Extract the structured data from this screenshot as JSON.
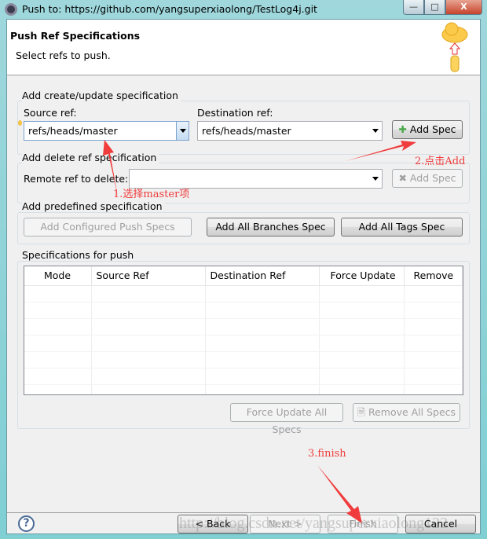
{
  "window": {
    "title": "Push to: https://github.com/yangsuperxiaolong/TestLog4j.git",
    "minimize": "—",
    "maximize": "□",
    "close": "X"
  },
  "header": {
    "title": "Push Ref Specifications",
    "subtitle": "Select refs to push.",
    "icon": "cloud-push-icon"
  },
  "create_group": {
    "title": "Add create/update specification",
    "source_label": "Source ref:",
    "source_value": "refs/heads/master",
    "dest_label": "Destination ref:",
    "dest_value": "refs/heads/master",
    "add_button": "Add Spec"
  },
  "delete_group": {
    "title": "Add delete ref specification",
    "remote_label": "Remote ref to delete:",
    "remote_value": "",
    "add_button": "Add Spec"
  },
  "predefined_group": {
    "title": "Add predefined specification",
    "buttons": [
      "Add Configured Push Specs",
      "Add All Branches Spec",
      "Add All Tags Spec"
    ]
  },
  "specs_group": {
    "title": "Specifications for push",
    "columns": [
      "Mode",
      "Source Ref",
      "Destination Ref",
      "Force Update",
      "Remove"
    ],
    "rows": [],
    "force_all": "Force Update All Specs",
    "remove_all": "Remove All Specs"
  },
  "footer": {
    "back": "< Back",
    "next": "Next >",
    "finish": "Finish",
    "cancel": "Cancel"
  },
  "annotations": {
    "step1": "1.选择master项",
    "step2": "2.点击Add",
    "step3": "3.finish",
    "color": "#f03c3c"
  },
  "watermark": "http://blog.csdn.net/yangsuperxiaolong123"
}
